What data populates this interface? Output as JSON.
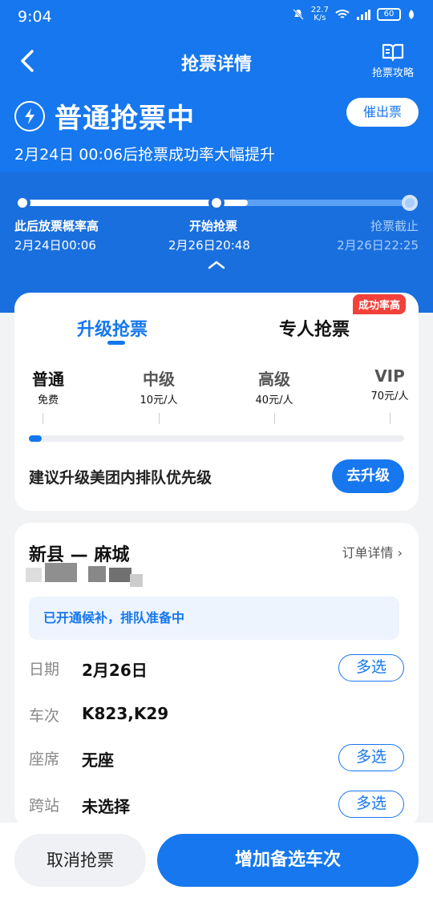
{
  "status_bar": {
    "time": "9:04",
    "speed": "22.7",
    "speed_unit": "K/s",
    "battery": "60"
  },
  "nav": {
    "title": "抢票详情",
    "guide_label": "抢票攻略"
  },
  "status": {
    "title": "普通抢票中",
    "urge_label": "催出票",
    "hint": "2月24日 00:06后抢票成功率大幅提升"
  },
  "timeline": {
    "progress": 0.58,
    "steps": [
      {
        "label": "此后放票概率高",
        "time": "2月24日00:06"
      },
      {
        "label": "开始抢票",
        "time": "2月26日20:48"
      },
      {
        "label": "抢票截止",
        "time": "2月26日22:25"
      }
    ]
  },
  "upgrade": {
    "tab_upgrade": "升级抢票",
    "tab_pro": "专人抢票",
    "badge": "成功率高",
    "tiers": [
      {
        "name": "普通",
        "price": "免费"
      },
      {
        "name": "中级",
        "price": "10元/人"
      },
      {
        "name": "高级",
        "price": "40元/人"
      },
      {
        "name": "VIP",
        "price": "70元/人"
      }
    ],
    "level_fraction": 0.03,
    "suggestion": "建议升级美团内排队优先级",
    "go_label": "去升级"
  },
  "order": {
    "route": "新县 — 麻城",
    "detail_link": "订单详情 ›",
    "notice": "已开通候补，排队准备中",
    "rows": [
      {
        "key": "日期",
        "value": "2月26日",
        "action": "多选"
      },
      {
        "key": "车次",
        "value": "K823,K29",
        "action": ""
      },
      {
        "key": "座席",
        "value": "无座",
        "action": "多选"
      },
      {
        "key": "跨站",
        "value": "未选择",
        "action": "多选"
      }
    ]
  },
  "bottom": {
    "cancel_label": "取消抢票",
    "add_label": "增加备选车次"
  },
  "colors": {
    "primary": "#1677ee",
    "badge_red": "#f2413a"
  }
}
